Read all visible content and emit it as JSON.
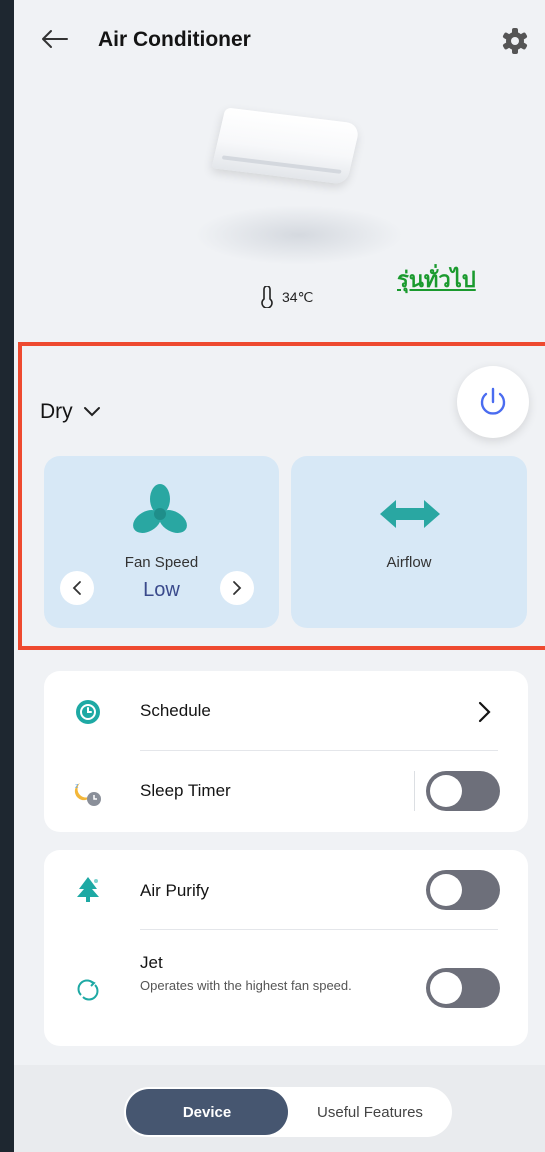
{
  "header": {
    "title": "Air Conditioner",
    "back_icon": "arrow-left-icon",
    "settings_icon": "gear-icon"
  },
  "overlay": {
    "label": "รุ่นทั่วไป",
    "color": "#1a9a2e"
  },
  "status": {
    "temperature": "34℃",
    "temp_icon": "thermometer-icon"
  },
  "controls": {
    "mode": "Dry",
    "power_icon": "power-icon",
    "fan_card": {
      "label": "Fan Speed",
      "value": "Low",
      "icon": "fan-icon"
    },
    "airflow_card": {
      "label": "Airflow",
      "icon": "airflow-arrows-icon"
    }
  },
  "list_one": [
    {
      "label": "Schedule",
      "icon": "clock-icon",
      "control": "chevron"
    },
    {
      "label": "Sleep Timer",
      "icon": "sleep-moon-icon",
      "control": "toggle",
      "on": false
    }
  ],
  "list_two": [
    {
      "label": "Air Purify",
      "icon": "tree-icon",
      "control": "toggle",
      "on": false
    },
    {
      "label": "Jet",
      "sub": "Operates with the highest fan speed.",
      "icon": "jet-swirl-icon",
      "control": "toggle",
      "on": false
    }
  ],
  "tabs": {
    "device": "Device",
    "features": "Useful Features",
    "active": "Device"
  },
  "colors": {
    "accent": "#465670",
    "card": "#d7e8f6",
    "highlight": "#ee4a30",
    "icon_teal": "#29a7a2"
  }
}
